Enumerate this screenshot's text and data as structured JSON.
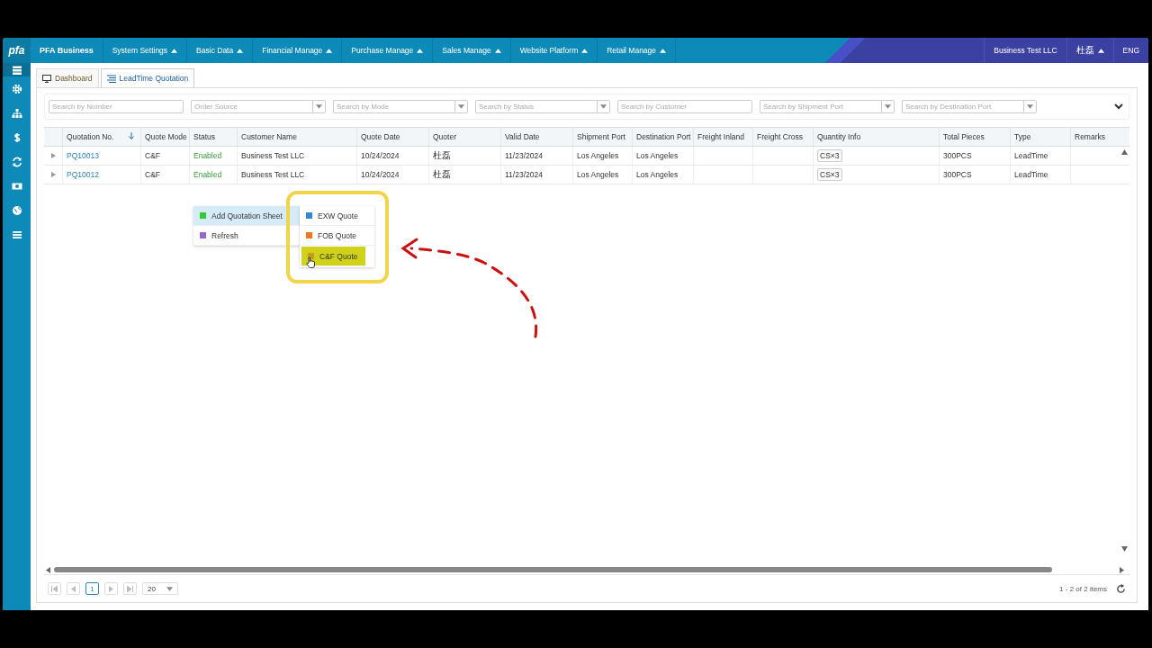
{
  "brand": {
    "logo": "pfa",
    "name": "PFA Business"
  },
  "menu": [
    {
      "label": "System Settings"
    },
    {
      "label": "Basic Data"
    },
    {
      "label": "Financial Manage"
    },
    {
      "label": "Purchase Manage"
    },
    {
      "label": "Sales Manage"
    },
    {
      "label": "Website Platform"
    },
    {
      "label": "Retail Manage"
    }
  ],
  "user": {
    "company": "Business Test LLC",
    "name": "杜磊",
    "language": "ENG"
  },
  "sidebar": {
    "items": [
      {
        "kind": "list",
        "selected": true
      },
      {
        "kind": "gear",
        "selected": false
      },
      {
        "kind": "tree",
        "selected": false
      },
      {
        "kind": "dollar",
        "selected": false
      },
      {
        "kind": "sync",
        "selected": false
      },
      {
        "kind": "cash",
        "selected": false
      },
      {
        "kind": "globe",
        "selected": false
      },
      {
        "kind": "menu",
        "selected": false
      }
    ]
  },
  "tabs": [
    {
      "label": "Dashboard",
      "kind": "monitor",
      "selected": false
    },
    {
      "label": "LeadTime Quotation",
      "kind": "list",
      "selected": true
    }
  ],
  "filters": [
    {
      "placeholder": "Search by Number",
      "kind": "text"
    },
    {
      "placeholder": "Order Source",
      "kind": "select"
    },
    {
      "placeholder": "Search by Mode",
      "kind": "select"
    },
    {
      "placeholder": "Search by Status",
      "kind": "select"
    },
    {
      "placeholder": "Search by Customer",
      "kind": "text"
    },
    {
      "placeholder": "Search by Shipment Port",
      "kind": "select"
    },
    {
      "placeholder": "Search by Destination Port",
      "kind": "select"
    }
  ],
  "table": {
    "columns": [
      {
        "label": "Quotation No.",
        "kind": "link",
        "sorted": true
      },
      {
        "label": "Quote Mode",
        "kind": "text",
        "sorted": false
      },
      {
        "label": "Status",
        "kind": "status",
        "sorted": false
      },
      {
        "label": "Customer Name",
        "kind": "text",
        "sorted": false
      },
      {
        "label": "Quote Date",
        "kind": "text",
        "sorted": false
      },
      {
        "label": "Quoter",
        "kind": "person",
        "sorted": false
      },
      {
        "label": "Valid Date",
        "kind": "text",
        "sorted": false
      },
      {
        "label": "Shipment Port",
        "kind": "text",
        "sorted": false
      },
      {
        "label": "Destination Port",
        "kind": "text",
        "sorted": false
      },
      {
        "label": "Freight Inland",
        "sorted": false
      },
      {
        "label": "Freight Cross",
        "sorted": false
      },
      {
        "label": "Quantity Info",
        "kind": "tag",
        "sorted": false
      },
      {
        "label": "Total Pieces",
        "kind": "text",
        "sorted": false
      },
      {
        "label": "Type",
        "kind": "text",
        "sorted": false
      },
      {
        "label": "Remarks",
        "sorted": false
      }
    ],
    "rows": [
      {
        "cells": [
          "PQ10013",
          "C&F",
          "Enabled",
          "Business Test LLC",
          "10/24/2024",
          "杜磊",
          "11/23/2024",
          "Los Angeles",
          "Los Angeles",
          null,
          null,
          "CS×3",
          "300PCS",
          "LeadTime",
          null
        ]
      },
      {
        "cells": [
          "PQ10012",
          "C&F",
          "Enabled",
          "Business Test LLC",
          "10/24/2024",
          "杜磊",
          "11/23/2024",
          "Los Angeles",
          "Los Angeles",
          null,
          null,
          "CS×3",
          "300PCS",
          "LeadTime",
          null
        ]
      }
    ]
  },
  "context_menu": {
    "items": [
      {
        "label": "Add Quotation Sheet",
        "color": "#33cc33",
        "selected": true
      },
      {
        "label": "Refresh",
        "color": "#9966cc",
        "selected": false
      }
    ],
    "submenu": [
      {
        "label": "EXW Quote",
        "color": "#3388dd",
        "selected": false
      },
      {
        "label": "FOB Quote",
        "color": "#ee7722",
        "selected": false
      },
      {
        "label": "C&F Quote",
        "color": "#cc9922",
        "selected": true
      }
    ]
  },
  "pager": {
    "page": "1",
    "page_size": "20",
    "summary": "1 - 2 of 2 items"
  }
}
